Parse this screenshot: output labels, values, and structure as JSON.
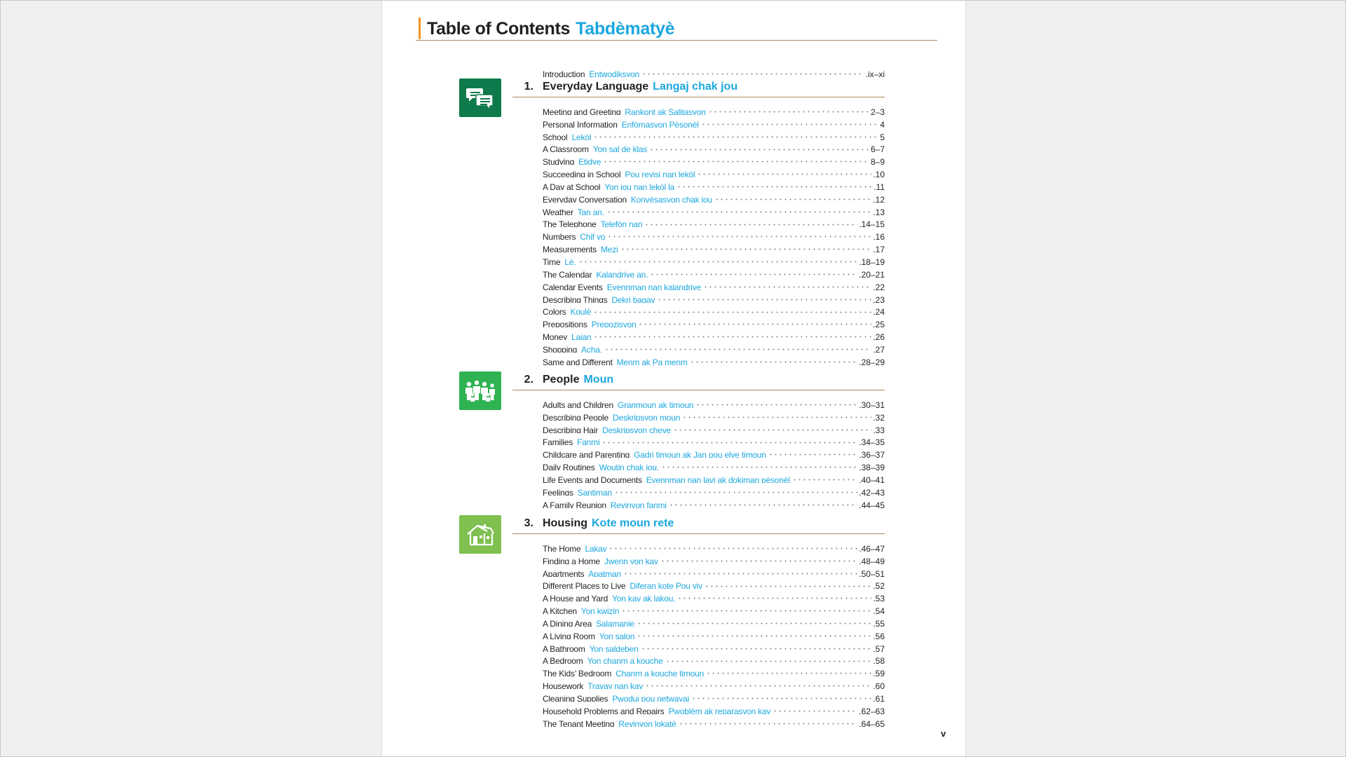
{
  "page": {
    "title": "Table of Contents",
    "title_ht": "Tabdèmatyè",
    "page_number": "v"
  },
  "introduction": {
    "en": "Introduction",
    "ht": "Entwodiksyon",
    "pages": ".ix–xi"
  },
  "colors": {
    "orange_accent": "#f39323",
    "blue_translation": "#1ba7df",
    "unit1_green": "#0f7a4b",
    "unit2_green": "#2fb352",
    "unit3_green": "#7fc050",
    "rule_brown": "#a98a5f"
  },
  "units": [
    {
      "num": "1.",
      "title": "Everyday Language",
      "title_ht": "Langaj chak jou",
      "icon": "speech-bubbles-icon",
      "entries": [
        {
          "en": "Meeting and Greeting",
          "ht": "Rankont ak Salitasyon",
          "pages": "2–3"
        },
        {
          "en": "Personal Information",
          "ht": "Enfòmasyon Pèsonèl",
          "pages": "4"
        },
        {
          "en": "School",
          "ht": "Lekòl",
          "pages": "5"
        },
        {
          "en": "A Classroom",
          "ht": "Yon sal de klas",
          "pages": "6–7"
        },
        {
          "en": "Studying",
          "ht": "Etidye",
          "pages": "8–9"
        },
        {
          "en": "Succeeding in School",
          "ht": "Pou reyisi nan lekòl",
          "pages": ".10"
        },
        {
          "en": "A Day at School",
          "ht": "Yon jou nan lekòl la",
          "pages": ".11"
        },
        {
          "en": "Everyday Conversation",
          "ht": "Konvèsasyon chak jou",
          "pages": ".12"
        },
        {
          "en": "Weather",
          "ht": "Tan an.",
          "pages": ".13"
        },
        {
          "en": "The Telephone",
          "ht": "Telefòn nan",
          "pages": ".14–15"
        },
        {
          "en": "Numbers",
          "ht": "Chif yo",
          "pages": ".16"
        },
        {
          "en": "Measurements",
          "ht": "Mezi",
          "pages": ".17"
        },
        {
          "en": "Time",
          "ht": "Lè.",
          "pages": ".18–19"
        },
        {
          "en": "The Calendar",
          "ht": "Kalandriye an.",
          "pages": ".20–21"
        },
        {
          "en": "Calendar Events",
          "ht": "Evennman nan kalandriye",
          "pages": ".22"
        },
        {
          "en": "Describing Things",
          "ht": "Dekri bagay",
          "pages": ".23"
        },
        {
          "en": "Colors",
          "ht": "Koulè",
          "pages": ".24"
        },
        {
          "en": "Prepositions",
          "ht": "Prepozisyon",
          "pages": ".25"
        },
        {
          "en": "Money",
          "ht": "Lajan",
          "pages": ".26"
        },
        {
          "en": "Shopping",
          "ht": "Acha.",
          "pages": ".27"
        },
        {
          "en": "Same and Different",
          "ht": "Menm ak Pa menm",
          "pages": ".28–29"
        }
      ]
    },
    {
      "num": "2.",
      "title": "People",
      "title_ht": "Moun",
      "icon": "people-group-icon",
      "entries": [
        {
          "en": "Adults and Children",
          "ht": "Granmoun ak timoun",
          "pages": ".30–31"
        },
        {
          "en": "Describing People",
          "ht": "Deskripsyon moun",
          "pages": ".32"
        },
        {
          "en": "Describing Hair",
          "ht": "Deskripsyon cheve",
          "pages": ".33"
        },
        {
          "en": "Families",
          "ht": "Fanmi",
          "pages": ".34–35"
        },
        {
          "en": "Childcare and Parenting",
          "ht": "Gadri timoun ak Jan pou elve timoun",
          "pages": ".36–37"
        },
        {
          "en": "Daily Routines",
          "ht": "Woutin chak jou.",
          "pages": ".38–39"
        },
        {
          "en": "Life Events and Documents",
          "ht": "Evennman nan lavi ak dokiman pèsonèl",
          "pages": ".40–41"
        },
        {
          "en": "Feelings",
          "ht": "Santiman",
          "pages": ".42–43"
        },
        {
          "en": "A Family Reunion",
          "ht": "Reyinyon fanmi",
          "pages": ".44–45"
        }
      ]
    },
    {
      "num": "3.",
      "title": "Housing",
      "title_ht": "Kote moun rete",
      "icon": "house-icon",
      "entries": [
        {
          "en": "The Home",
          "ht": "Lakay",
          "pages": ".46–47"
        },
        {
          "en": "Finding a Home",
          "ht": "Jwenn yon kay",
          "pages": ".48–49"
        },
        {
          "en": "Apartments",
          "ht": "Apatman",
          "pages": ".50–51"
        },
        {
          "en": "Different Places to Live",
          "ht": "Diferan kote Pou viv",
          "pages": ".52"
        },
        {
          "en": "A House and Yard",
          "ht": "Yon kay ak lakou.",
          "pages": ".53"
        },
        {
          "en": "A Kitchen",
          "ht": "Yon kwizin",
          "pages": ".54"
        },
        {
          "en": "A Dining Area",
          "ht": "Salamanje",
          "pages": ".55"
        },
        {
          "en": "A Living Room",
          "ht": "Yon salon",
          "pages": ".56"
        },
        {
          "en": "A Bathroom",
          "ht": "Yon saldeben",
          "pages": ".57"
        },
        {
          "en": "A Bedroom",
          "ht": "Yon chanm a kouche",
          "pages": ".58"
        },
        {
          "en": "The Kids’ Bedroom",
          "ht": "Chanm a kouche timoun",
          "pages": ".59"
        },
        {
          "en": "Housework",
          "ht": "Travay nan kay",
          "pages": ".60"
        },
        {
          "en": "Cleaning Supplies",
          "ht": "Pwodui pou netwayaj",
          "pages": ".61"
        },
        {
          "en": "Household Problems and Repairs",
          "ht": "Pwoblèm ak reparasyon kay",
          "pages": ".62–63"
        },
        {
          "en": "The Tenant Meeting",
          "ht": "Reyinyon lokatè",
          "pages": ".64–65"
        }
      ]
    }
  ]
}
